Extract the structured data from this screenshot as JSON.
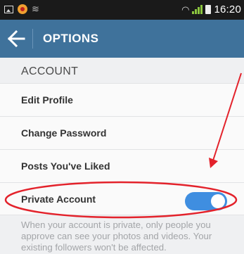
{
  "status_bar": {
    "time": "16:20"
  },
  "header": {
    "title": "OPTIONS"
  },
  "section": {
    "title": "ACCOUNT"
  },
  "items": [
    {
      "label": "Edit Profile"
    },
    {
      "label": "Change Password"
    },
    {
      "label": "Posts You've Liked"
    },
    {
      "label": "Private Account",
      "toggle_on": true
    }
  ],
  "helper_text": "When your account is private, only people you approve can see your photos and videos. Your existing followers won't be affected.",
  "colors": {
    "app_bar": "#3f729b",
    "toggle_on": "#3f8ee0",
    "annotation_red": "#e3222b"
  }
}
